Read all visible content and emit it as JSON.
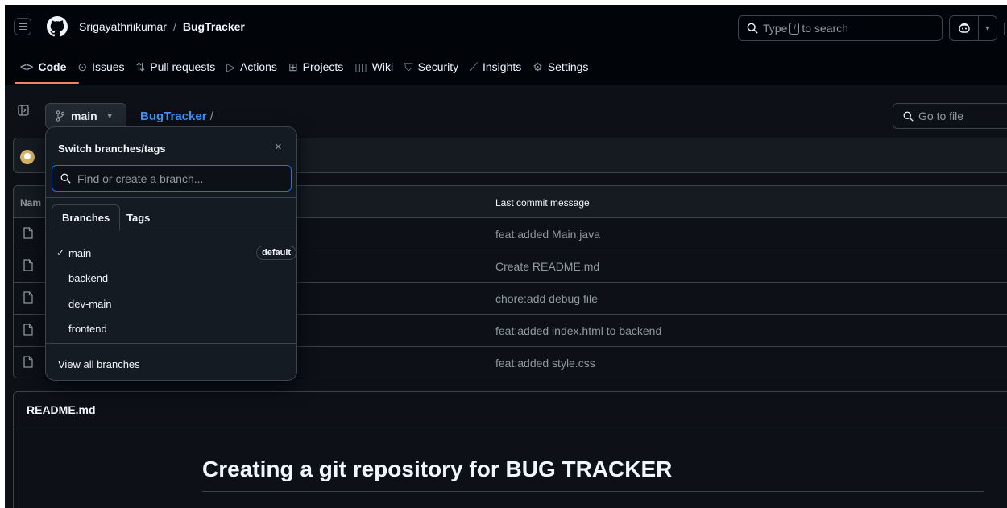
{
  "header": {
    "owner": "Srigayathriikumar",
    "separator": "/",
    "repo": "BugTracker",
    "search": {
      "prefix": "Type",
      "key": "/",
      "suffix": "to search"
    }
  },
  "nav": {
    "tabs": [
      {
        "label": "Code",
        "icon": "code-icon",
        "glyph": "<>"
      },
      {
        "label": "Issues",
        "icon": "issue-icon",
        "glyph": "⊙"
      },
      {
        "label": "Pull requests",
        "icon": "pull-request-icon",
        "glyph": "⇅"
      },
      {
        "label": "Actions",
        "icon": "play-icon",
        "glyph": "▷"
      },
      {
        "label": "Projects",
        "icon": "table-icon",
        "glyph": "⊞"
      },
      {
        "label": "Wiki",
        "icon": "book-icon",
        "glyph": "▯▯"
      },
      {
        "label": "Security",
        "icon": "shield-icon",
        "glyph": "⛉"
      },
      {
        "label": "Insights",
        "icon": "graph-icon",
        "glyph": "⟋"
      },
      {
        "label": "Settings",
        "icon": "gear-icon",
        "glyph": "⚙"
      }
    ]
  },
  "repobar": {
    "branch": "main",
    "path_repo": "BugTracker",
    "path_slash": "/",
    "goto_file": "Go to file"
  },
  "files": {
    "header_name": "Nam",
    "header_message": "Last commit message",
    "rows": [
      {
        "message": "feat:added Main.java"
      },
      {
        "message": "Create README.md"
      },
      {
        "message": "chore:add debug file"
      },
      {
        "message": "feat:added index.html to backend"
      },
      {
        "message": "feat:added style.css"
      }
    ]
  },
  "readme": {
    "filename": "README.md",
    "title": "Creating a git repository for BUG TRACKER"
  },
  "dropdown": {
    "title": "Switch branches/tags",
    "close": "×",
    "placeholder": "Find or create a branch...",
    "tabs": [
      "Branches",
      "Tags"
    ],
    "branches": [
      {
        "name": "main",
        "selected": true,
        "badge": "default"
      },
      {
        "name": "backend"
      },
      {
        "name": "dev-main"
      },
      {
        "name": "frontend"
      }
    ],
    "view_all": "View all branches"
  },
  "colors": {
    "background": "#0d1117",
    "header": "#010409",
    "border": "#3d444d",
    "link": "#4493f8",
    "focus": "#1f6feb",
    "muted": "#9198a1",
    "tab_underline": "#f78166"
  }
}
